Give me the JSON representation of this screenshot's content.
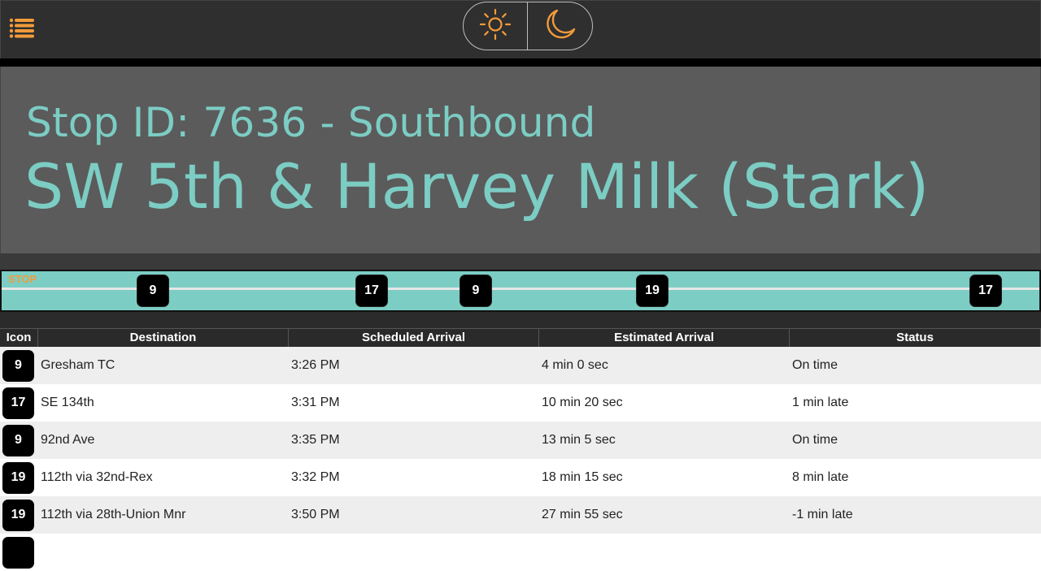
{
  "header": {
    "stop_line": "Stop ID: 7636 - Southbound",
    "stop_name": "SW 5th & Harvey Milk (Stark)"
  },
  "theme": {
    "light_icon": "sun-icon",
    "dark_icon": "moon-icon",
    "accent": "#f39b3a"
  },
  "route_strip": {
    "stop_label": "STOP",
    "color": "#7ccdc4",
    "buses": [
      {
        "route": "9"
      },
      {
        "route": "17"
      },
      {
        "route": "9"
      },
      {
        "route": "19"
      },
      {
        "route": "17"
      }
    ]
  },
  "table": {
    "columns": [
      "Icon",
      "Destination",
      "Scheduled Arrival",
      "Estimated Arrival",
      "Status"
    ],
    "rows": [
      {
        "route": "9",
        "destination": "Gresham TC",
        "scheduled": "3:26 PM",
        "estimated": "4 min 0 sec",
        "status": "On time"
      },
      {
        "route": "17",
        "destination": "SE 134th",
        "scheduled": "3:31 PM",
        "estimated": "10 min 20 sec",
        "status": "1 min late"
      },
      {
        "route": "9",
        "destination": "92nd Ave",
        "scheduled": "3:35 PM",
        "estimated": "13 min 5 sec",
        "status": "On time"
      },
      {
        "route": "19",
        "destination": "112th via 32nd-Rex",
        "scheduled": "3:32 PM",
        "estimated": "18 min 15 sec",
        "status": "8 min late"
      },
      {
        "route": "19",
        "destination": "112th via 28th-Union Mnr",
        "scheduled": "3:50 PM",
        "estimated": "27 min 55 sec",
        "status": "-1 min late"
      }
    ]
  }
}
